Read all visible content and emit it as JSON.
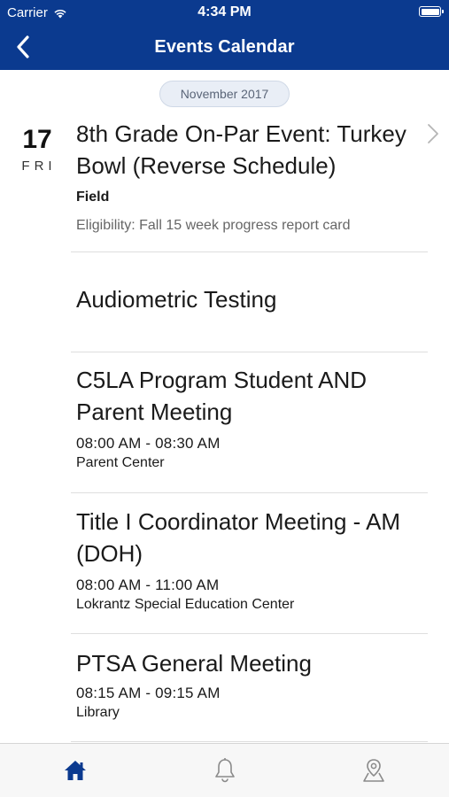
{
  "status_bar": {
    "carrier": "Carrier",
    "time": "4:34 PM"
  },
  "nav": {
    "title": "Events Calendar"
  },
  "month_label": "November 2017",
  "date": {
    "day_number": "17",
    "day_of_week": "FRI"
  },
  "events": [
    {
      "title": "8th Grade On-Par Event: Turkey Bowl (Reverse Schedule)",
      "location": "Field",
      "note": "Eligibility: Fall 15 week progress report card"
    },
    {
      "title": "Audiometric Testing"
    },
    {
      "title": "C5LA Program Student AND Parent Meeting",
      "time": "08:00 AM - 08:30 AM",
      "location": "Parent Center"
    },
    {
      "title": "Title I Coordinator Meeting - AM (DOH)",
      "time": "08:00 AM - 11:00 AM",
      "location": "Lokrantz Special Education Center"
    },
    {
      "title": "PTSA General Meeting",
      "time": "08:15 AM - 09:15 AM",
      "location": "Library"
    }
  ],
  "tabs": [
    {
      "icon": "home-icon",
      "active": true
    },
    {
      "icon": "bell-icon",
      "active": false
    },
    {
      "icon": "map-pin-icon",
      "active": false
    }
  ],
  "colors": {
    "brand_blue": "#0b3a8f",
    "tab_active": "#0b3a8f",
    "tab_inactive": "#8a8a8a"
  }
}
